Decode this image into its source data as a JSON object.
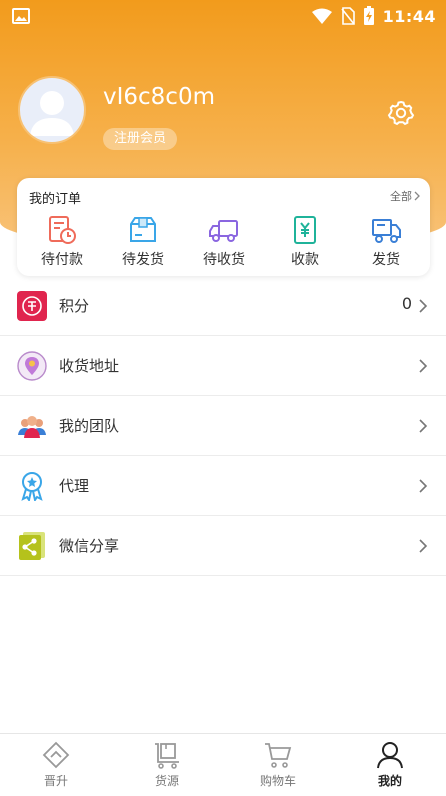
{
  "status_bar": {
    "time": "11:44"
  },
  "profile": {
    "username": "vI6c8c0m",
    "member_level": "注册会员"
  },
  "orders": {
    "title": "我的订单",
    "all_label": "全部",
    "items": [
      {
        "label": "待付款",
        "icon": "pending-payment-icon",
        "color": "#ef6b5a"
      },
      {
        "label": "待发货",
        "icon": "pending-shipment-icon",
        "color": "#3aa6e8"
      },
      {
        "label": "待收货",
        "icon": "pending-receipt-icon",
        "color": "#8a66e0"
      },
      {
        "label": "收款",
        "icon": "collect-payment-icon",
        "color": "#1fb39a"
      },
      {
        "label": "发货",
        "icon": "ship-icon",
        "color": "#3a7fd6"
      }
    ]
  },
  "menu": [
    {
      "label": "积分",
      "value": "0",
      "icon": "points-icon"
    },
    {
      "label": "收货地址",
      "value": "",
      "icon": "address-pin-icon"
    },
    {
      "label": "我的团队",
      "value": "",
      "icon": "team-icon"
    },
    {
      "label": "代理",
      "value": "",
      "icon": "agent-badge-icon"
    },
    {
      "label": "微信分享",
      "value": "",
      "icon": "share-icon"
    }
  ],
  "tabbar": [
    {
      "label": "晋升",
      "icon": "promote-icon",
      "active": false
    },
    {
      "label": "货源",
      "icon": "supply-icon",
      "active": false
    },
    {
      "label": "购物车",
      "icon": "cart-icon",
      "active": false
    },
    {
      "label": "我的",
      "icon": "profile-icon",
      "active": true
    }
  ],
  "colors": {
    "header": "#f29b1c",
    "accent": "#f6b04a"
  }
}
